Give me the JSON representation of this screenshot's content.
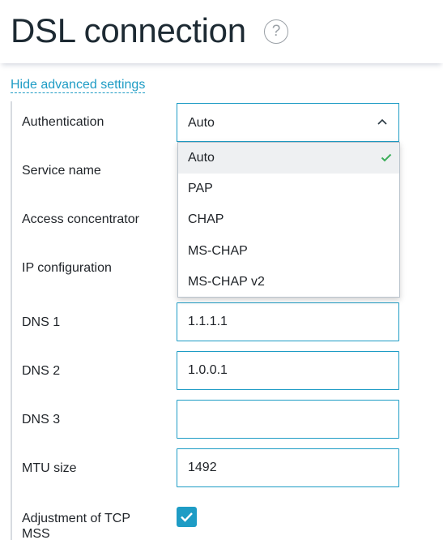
{
  "header": {
    "title": "DSL connection",
    "help_icon": "?"
  },
  "advanced_link": "Hide advanced settings",
  "fields": {
    "authentication": {
      "label": "Authentication",
      "value": "Auto"
    },
    "service_name": {
      "label": "Service name"
    },
    "access_concentrator": {
      "label": "Access concentrator"
    },
    "ip_configuration": {
      "label": "IP configuration"
    },
    "dns1": {
      "label": "DNS 1",
      "value": "1.1.1.1"
    },
    "dns2": {
      "label": "DNS 2",
      "value": "1.0.0.1"
    },
    "dns3": {
      "label": "DNS 3",
      "value": ""
    },
    "mtu": {
      "label": "MTU size",
      "value": "1492"
    },
    "tcp_mss": {
      "label_line1": "Adjustment of TCP",
      "label_line2": "MSS",
      "checked": true
    }
  },
  "dropdown": {
    "options": [
      "Auto",
      "PAP",
      "CHAP",
      "MS-CHAP",
      "MS-CHAP v2"
    ],
    "selected": "Auto"
  },
  "colors": {
    "accent": "#1e9cc5",
    "check": "#3cae5a"
  }
}
